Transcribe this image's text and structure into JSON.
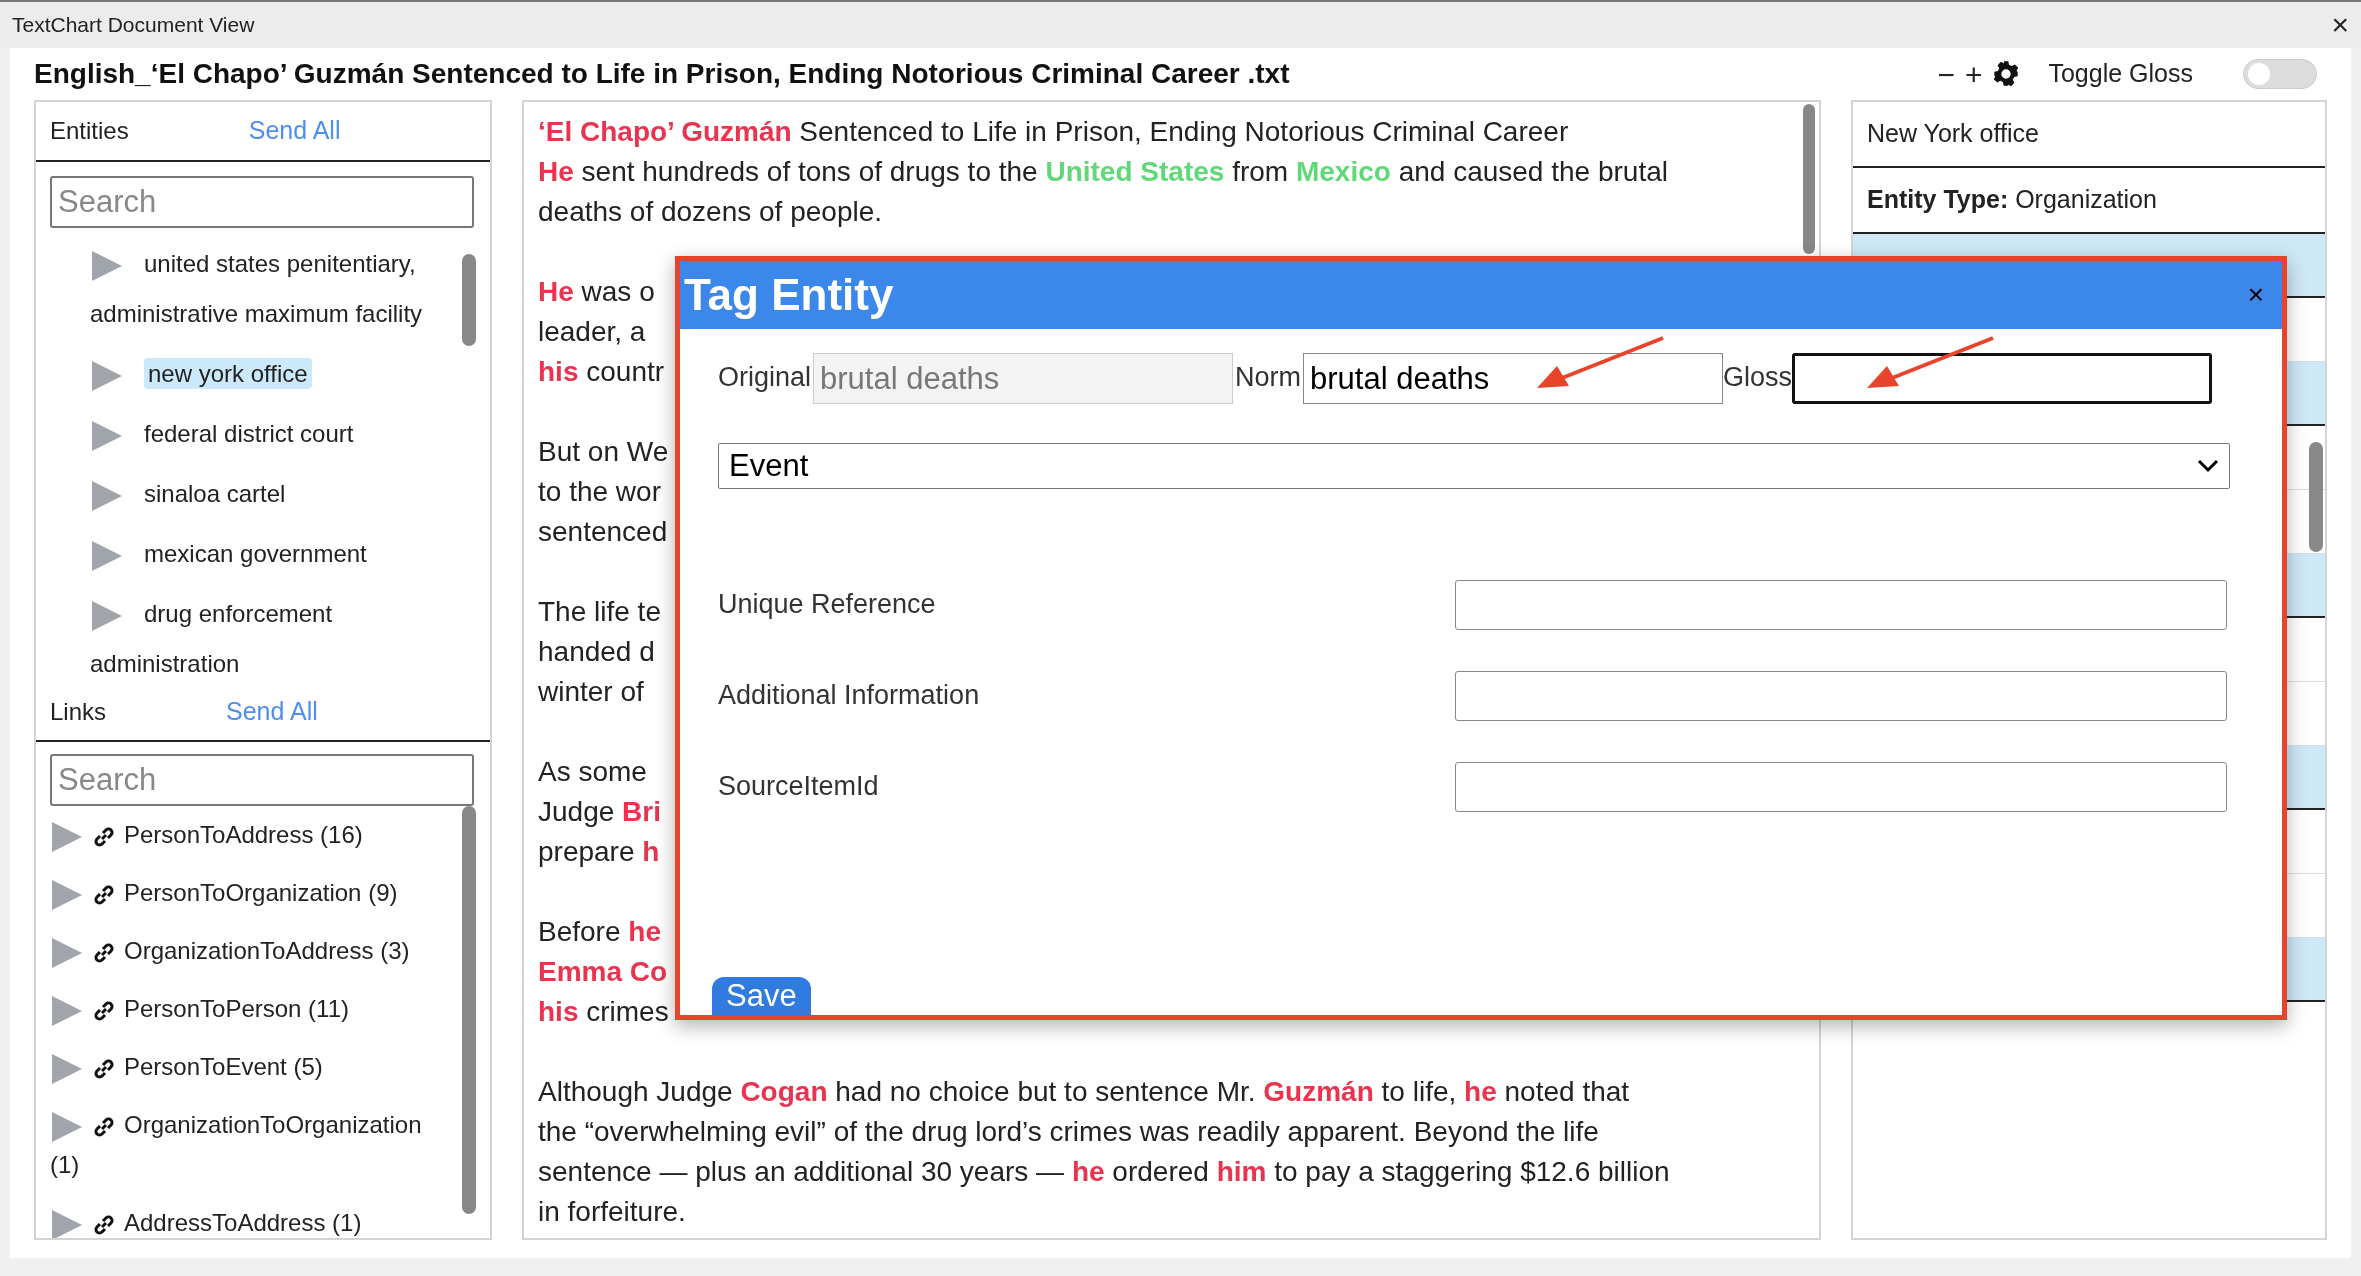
{
  "window": {
    "title": "TextChart Document View",
    "close": "×"
  },
  "document": {
    "title": "English_‘El Chapo’ Guzmán Sentenced to Life in Prison, Ending Notorious Criminal Career .txt"
  },
  "toolbar": {
    "zoom_out": "−",
    "zoom_in": "+",
    "toggle_label": "Toggle Gloss",
    "toggle_on": false
  },
  "entities": {
    "header": "Entities",
    "send_all": "Send All",
    "search_placeholder": "Search",
    "items": [
      {
        "label": "united states penitentiary, administrative maximum facility",
        "selected": false
      },
      {
        "label": "new york office",
        "selected": true
      },
      {
        "label": "federal district court",
        "selected": false
      },
      {
        "label": "sinaloa cartel",
        "selected": false
      },
      {
        "label": "mexican government",
        "selected": false
      },
      {
        "label": "drug enforcement administration",
        "selected": false
      }
    ]
  },
  "links": {
    "header": "Links",
    "send_all": "Send All",
    "search_placeholder": "Search",
    "items": [
      {
        "label": "PersonToAddress (16)"
      },
      {
        "label": "PersonToOrganization (9)"
      },
      {
        "label": "OrganizationToAddress (3)"
      },
      {
        "label": "PersonToPerson (11)"
      },
      {
        "label": "PersonToEvent (5)"
      },
      {
        "label": "OrganizationToOrganization (1)"
      },
      {
        "label": "AddressToAddress (1)"
      }
    ]
  },
  "text": [
    {
      "lines": [
        [
          {
            "t": "‘El Chapo’ Guzmán",
            "kind": "person"
          },
          {
            "t": " Sentenced to Life in Prison, Ending Notorious Criminal Career",
            "kind": "plain"
          }
        ],
        [
          {
            "t": "He",
            "kind": "person"
          },
          {
            "t": " sent hundreds of tons of drugs to the ",
            "kind": "plain"
          },
          {
            "t": "United States",
            "kind": "location"
          },
          {
            "t": " from ",
            "kind": "plain"
          },
          {
            "t": "Mexico",
            "kind": "location"
          },
          {
            "t": " and caused the brutal",
            "kind": "plain"
          }
        ],
        [
          {
            "t": "deaths of dozens of people.",
            "kind": "plain"
          }
        ]
      ]
    },
    {
      "lines": [
        [
          {
            "t": "He",
            "kind": "person"
          },
          {
            "t": " was o",
            "kind": "plain"
          }
        ],
        [
          {
            "t": "leader, a",
            "kind": "plain"
          }
        ],
        [
          {
            "t": "his",
            "kind": "person"
          },
          {
            "t": " countr",
            "kind": "plain"
          }
        ]
      ]
    },
    {
      "lines": [
        [
          {
            "t": "But on We",
            "kind": "plain"
          }
        ],
        [
          {
            "t": "to the wor",
            "kind": "plain"
          }
        ],
        [
          {
            "t": "sentenced",
            "kind": "plain"
          }
        ]
      ]
    },
    {
      "lines": [
        [
          {
            "t": "The life te",
            "kind": "plain"
          }
        ],
        [
          {
            "t": "handed d",
            "kind": "plain"
          }
        ],
        [
          {
            "t": "winter of",
            "kind": "plain"
          }
        ]
      ]
    },
    {
      "lines": [
        [
          {
            "t": "As some",
            "kind": "plain"
          }
        ],
        [
          {
            "t": "Judge ",
            "kind": "plain"
          },
          {
            "t": "Bri",
            "kind": "person"
          }
        ],
        [
          {
            "t": "prepare ",
            "kind": "plain"
          },
          {
            "t": "h",
            "kind": "person"
          }
        ]
      ]
    },
    {
      "lines": [
        [
          {
            "t": "Before ",
            "kind": "plain"
          },
          {
            "t": "he",
            "kind": "person"
          }
        ],
        [
          {
            "t": "Emma Co",
            "kind": "person"
          }
        ],
        [
          {
            "t": "his",
            "kind": "person"
          },
          {
            "t": " crimes",
            "kind": "plain"
          }
        ]
      ]
    },
    {
      "lines": [
        [
          {
            "t": "Although Judge ",
            "kind": "plain"
          },
          {
            "t": "Cogan",
            "kind": "person"
          },
          {
            "t": " had no choice but to sentence Mr. ",
            "kind": "plain"
          },
          {
            "t": "Guzmán",
            "kind": "person"
          },
          {
            "t": " to life, ",
            "kind": "plain"
          },
          {
            "t": "he",
            "kind": "person"
          },
          {
            "t": " noted that",
            "kind": "plain"
          }
        ],
        [
          {
            "t": "the “overwhelming evil” of the drug lord’s crimes was readily apparent. Beyond the life",
            "kind": "plain"
          }
        ],
        [
          {
            "t": "sentence — plus an additional 30 years — ",
            "kind": "plain"
          },
          {
            "t": "he",
            "kind": "person"
          },
          {
            "t": " ordered ",
            "kind": "plain"
          },
          {
            "t": "him",
            "kind": "person"
          },
          {
            "t": " to pay a staggering $12.6 billion",
            "kind": "plain"
          }
        ],
        [
          {
            "t": "in forfeiture.",
            "kind": "plain"
          }
        ]
      ]
    }
  ],
  "details": {
    "rows": [
      "New York office",
      "**Entity Type:** Organization"
    ]
  },
  "dialog": {
    "title": "Tag Entity",
    "close": "×",
    "original": {
      "label": "Original",
      "value": "brutal deaths",
      "disabled": true
    },
    "norm": {
      "label": "Norm",
      "value": "brutal deaths"
    },
    "gloss": {
      "label": "Gloss",
      "focused": true
    },
    "type": {
      "value": "Event"
    },
    "fields": [
      {
        "label": "Unique Reference"
      },
      {
        "label": "Additional Information"
      },
      {
        "label": "SourceItemId"
      }
    ],
    "save": "Save"
  }
}
